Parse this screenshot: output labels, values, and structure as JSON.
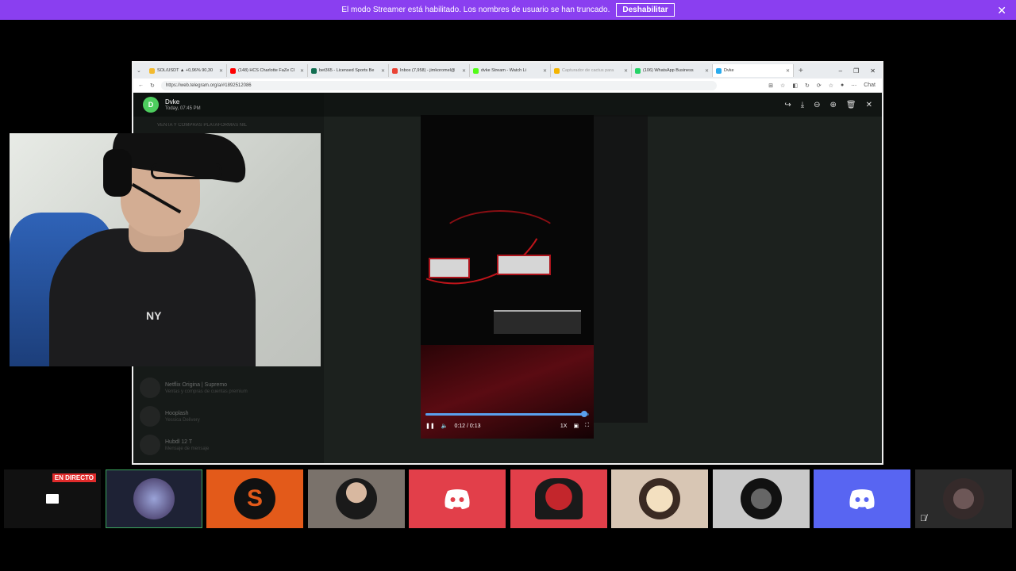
{
  "banner": {
    "text": "El modo Streamer está habilitado. Los nombres de usuario se han truncado.",
    "button_label": "Deshabilitar",
    "close_icon": "close-icon"
  },
  "browser": {
    "tabs": [
      {
        "label": "SOL/USDT ▲ +0,96% 90,30",
        "color": "#f3ba2f"
      },
      {
        "label": "(148) HCS Charlotte FaZe Cl",
        "color": "#ff0000"
      },
      {
        "label": "bet365 - Licensed Sports Be",
        "color": "#126e51"
      },
      {
        "label": "Inbox (7,958) - jimkoromel@",
        "color": "#ea4335"
      },
      {
        "label": "dvke Stream - Watch Li",
        "color": "#53fc18"
      },
      {
        "label": "Capturador de cactus para",
        "color": "#f4b400"
      },
      {
        "label": "(106) WhatsApp Business",
        "color": "#25d366"
      },
      {
        "label": "Dvke",
        "color": "#2aabee"
      }
    ],
    "url": "https://web.telegram.org/a/#1892512086",
    "chat_label": "Chat"
  },
  "telegram": {
    "sender_initial": "D",
    "sender_name": "Dvke",
    "timestamp": "Today, 07:45 PM",
    "pinned_text": "VENTA Y COMPRAS PLATAFORMAS NIL",
    "chats": [
      {
        "title": "Netflix Origina | Supremo",
        "sub": "Ventas y compras de cuentas premium"
      },
      {
        "title": "Hooplash",
        "sub": "Yessica Delivery"
      },
      {
        "title": "Hubdl 12 T",
        "sub": "Mensaje de mensaje"
      }
    ],
    "video": {
      "time_label": "0:12 / 0:13",
      "progress": 0.97,
      "speed_label": "1X"
    }
  },
  "tiles": {
    "live_label": "EN DIRECTO"
  },
  "colors": {
    "banner": "#8a3ff0",
    "discord_red": "#e23f4a",
    "discord_blurple": "#5865f2",
    "orange": "#e35a1a"
  }
}
